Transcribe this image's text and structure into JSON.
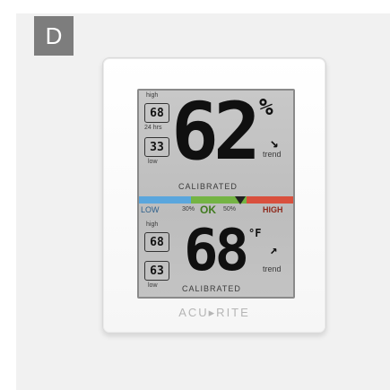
{
  "badge": "D",
  "lcd": {
    "humidity": {
      "high_label": "high",
      "high_value": "68",
      "period_label": "24 hrs",
      "low_value": "33",
      "low_label": "low",
      "value": "62",
      "unit": "%",
      "trend_arrow": "↘",
      "trend_label": "trend",
      "calibrated": "CALIBRATED"
    },
    "comfort_bar": {
      "low": "LOW",
      "range_low": "30%",
      "ok": "OK",
      "range_high": "50%",
      "high": "HIGH",
      "colors": {
        "low": "#5aa6dd",
        "ok": "#74b444",
        "high": "#d9503d"
      }
    },
    "temperature": {
      "high_label": "high",
      "high_value": "68",
      "low_value": "63",
      "low_label": "low",
      "value": "68",
      "unit": "°F",
      "trend_arrow": "↗",
      "trend_label": "trend",
      "calibrated": "CALIBRATED"
    }
  },
  "brand": "ACU▸RITE"
}
